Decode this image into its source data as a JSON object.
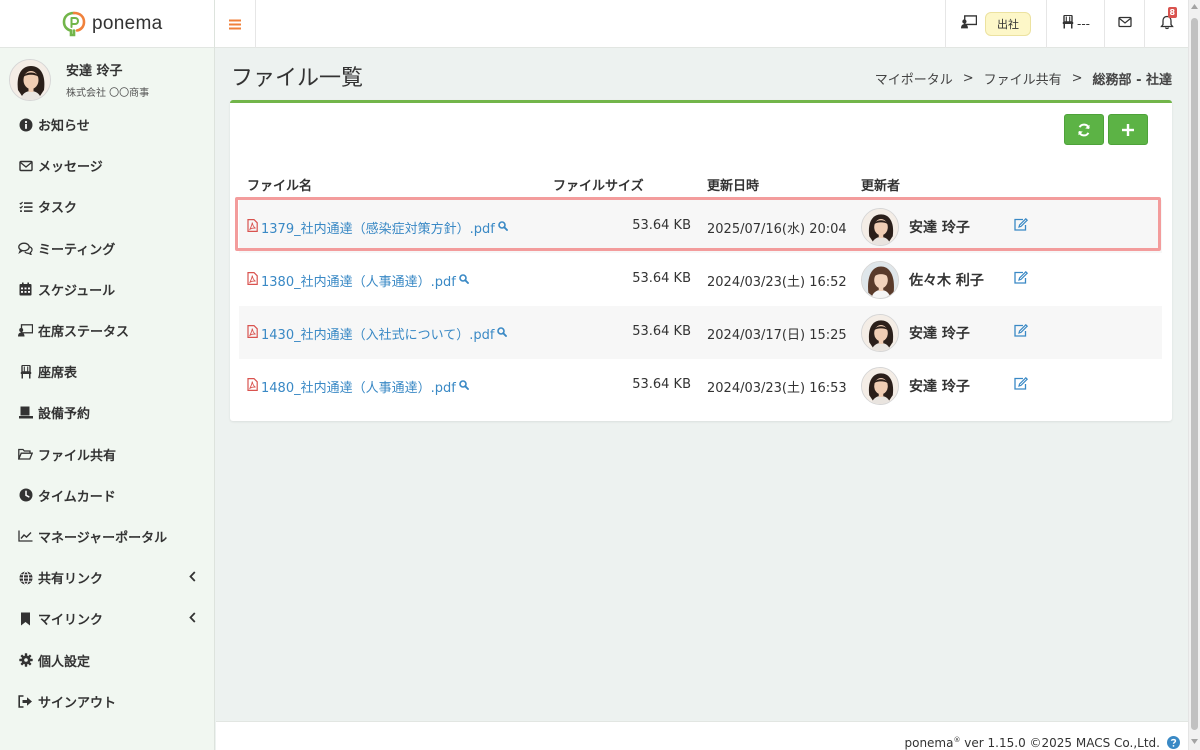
{
  "app": {
    "name": "ponema",
    "brand_color": "#72b54a",
    "accent_orange": "#f0813b"
  },
  "user": {
    "name": "安達 玲子",
    "company": "株式会社 〇〇商事"
  },
  "nav": {
    "items": [
      {
        "label": "お知らせ",
        "icon": "info-circle-icon"
      },
      {
        "label": "メッセージ",
        "icon": "envelope-icon"
      },
      {
        "label": "タスク",
        "icon": "list-check-icon"
      },
      {
        "label": "ミーティング",
        "icon": "comments-icon"
      },
      {
        "label": "スケジュール",
        "icon": "calendar-icon"
      },
      {
        "label": "在席ステータス",
        "icon": "presence-icon"
      },
      {
        "label": "座席表",
        "icon": "chair-icon"
      },
      {
        "label": "設備予約",
        "icon": "facility-icon"
      },
      {
        "label": "ファイル共有",
        "icon": "folder-open-icon"
      },
      {
        "label": "タイムカード",
        "icon": "clock-icon"
      },
      {
        "label": "マネージャーポータル",
        "icon": "chart-line-icon"
      },
      {
        "label": "共有リンク",
        "icon": "globe-icon"
      },
      {
        "label": "マイリンク",
        "icon": "bookmark-icon"
      },
      {
        "label": "個人設定",
        "icon": "gear-icon"
      },
      {
        "label": "サインアウト",
        "icon": "sign-out-icon"
      }
    ]
  },
  "header": {
    "attendance_label": "出社",
    "seat_label": "---",
    "notification_count": "8"
  },
  "page": {
    "title": "ファイル一覧",
    "breadcrumb": [
      "マイポータル",
      "ファイル共有",
      "総務部 - 社達"
    ],
    "breadcrumb_sep": ">"
  },
  "table": {
    "columns": [
      "ファイル名",
      "ファイルサイズ",
      "更新日時",
      "更新者"
    ],
    "rows": [
      {
        "file": "1379_社内通達（感染症対策方針）.pdf",
        "size": "53.64 KB",
        "date": "2025/07/16(水) 20:04",
        "updater": "安達 玲子"
      },
      {
        "file": "1380_社内通達（人事通達）.pdf",
        "size": "53.64 KB",
        "date": "2024/03/23(土) 16:52",
        "updater": "佐々木 利子"
      },
      {
        "file": "1430_社内通達（入社式について）.pdf",
        "size": "53.64 KB",
        "date": "2024/03/17(日) 15:25",
        "updater": "安達 玲子"
      },
      {
        "file": "1480_社内通達（人事通達）.pdf",
        "size": "53.64 KB",
        "date": "2024/03/23(土) 16:53",
        "updater": "安達 玲子"
      }
    ]
  },
  "footer": {
    "brand": "ponema",
    "reg": "®",
    "text": " ver 1.15.0 ©2025 MACS Co.,Ltd."
  }
}
